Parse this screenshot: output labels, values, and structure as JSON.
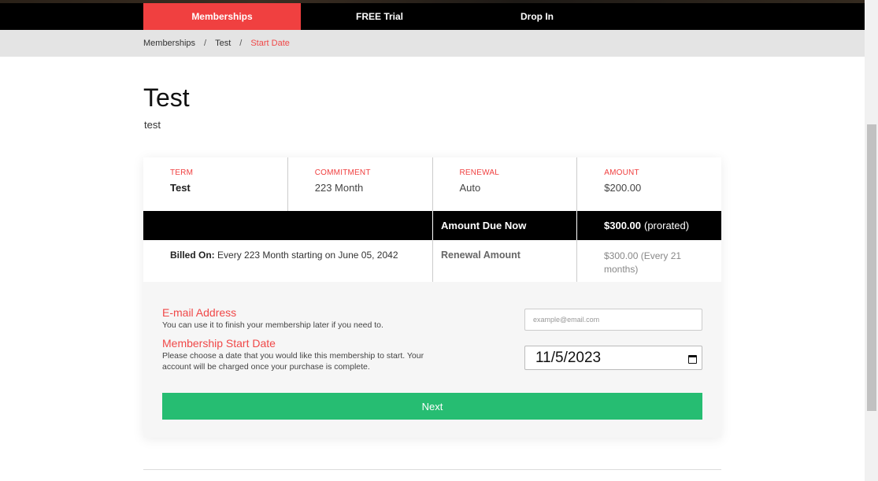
{
  "nav": {
    "tabs": [
      {
        "label": "Memberships",
        "active": true
      },
      {
        "label": "FREE Trial",
        "active": false
      },
      {
        "label": "Drop In",
        "active": false
      }
    ]
  },
  "breadcrumb": [
    "Memberships",
    "Test",
    "Start Date"
  ],
  "page": {
    "title": "Test",
    "subtitle": "test"
  },
  "summary": {
    "term": {
      "label": "TERM",
      "value": "Test"
    },
    "commitment": {
      "label": "COMMITMENT",
      "value": "223 Month"
    },
    "renewal": {
      "label": "RENEWAL",
      "value": "Auto"
    },
    "amount": {
      "label": "AMOUNT",
      "value": "$200.00"
    },
    "due_now_label": "Amount Due Now",
    "due_now_value": "$300.00",
    "due_now_note": "(prorated)",
    "billed_on_label": "Billed On:",
    "billed_on_value": "Every 223 Month starting on June 05, 2042",
    "renewal_amount_label": "Renewal Amount",
    "renewal_amount_value": "$300.00 (Every 21 months)"
  },
  "form": {
    "email_label": "E-mail Address",
    "email_help": "You can use it to finish your membership later if you need to.",
    "email_placeholder": "example@email.com",
    "start_label": "Membership Start Date",
    "start_help": "Please choose a date that you would like this membership to start. Your account will be charged once your purchase is complete.",
    "start_value": "11/5/2023",
    "next_label": "Next"
  },
  "colors": {
    "accent": "#f04040",
    "nav_bg": "#000000",
    "next_button": "#26bd72"
  }
}
